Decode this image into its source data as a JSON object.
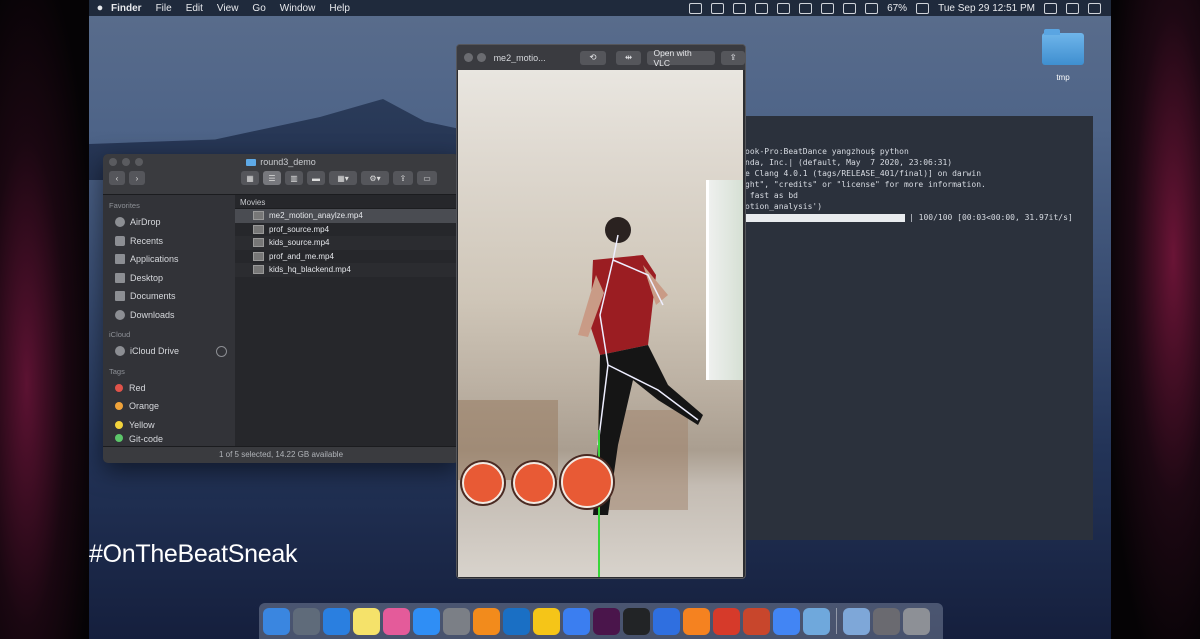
{
  "menubar": {
    "apple": "",
    "items": [
      "Finder",
      "File",
      "Edit",
      "View",
      "Go",
      "Window",
      "Help"
    ],
    "battery": "67%",
    "datetime": "Tue Sep 29  12:51 PM"
  },
  "desktop": {
    "folder_label": "tmp"
  },
  "terminal": {
    "lines": [
      "ook-Pro:BeatDance yangzhou$ python",
      "nda, Inc.| (default, May  7 2020, 23:06:31)",
      "e Clang 4.0.1 (tags/RELEASE_401/final)] on darwin",
      "ght\", \"credits\" or \"license\" for more information.",
      " fast as bd",
      "otion_analysis')"
    ],
    "progress_text": "| 100/100 [00:03<00:00, 31.97it/s]",
    "progress": 1.0
  },
  "finder": {
    "title": "round3_demo",
    "column_header": "Movies",
    "sidebar": {
      "favorites_header": "Favorites",
      "favorites": [
        "AirDrop",
        "Recents",
        "Applications",
        "Desktop",
        "Documents",
        "Downloads"
      ],
      "icloud_header": "iCloud",
      "icloud": [
        "iCloud Drive"
      ],
      "tags_header": "Tags",
      "tags": [
        {
          "label": "Red",
          "color": "#e0534a"
        },
        {
          "label": "Orange",
          "color": "#f0a33a"
        },
        {
          "label": "Yellow",
          "color": "#f2d33c"
        },
        {
          "label": "Git-code",
          "color": "#5cc66a"
        }
      ]
    },
    "files": [
      "me2_motion_anaylze.mp4",
      "prof_source.mp4",
      "kids_source.mp4",
      "prof_and_me.mp4",
      "kids_hq_blackend.mp4"
    ],
    "selected_index": 0,
    "status": "1 of 5 selected, 14.22 GB available"
  },
  "player": {
    "title": "me2_motio...",
    "open_with": "Open with VLC"
  },
  "overlay": {
    "hashtag": "#OnTheBeatSneak"
  },
  "dock": {
    "icons": [
      "finder-icon",
      "launchpad-icon",
      "safari-icon",
      "notes-icon",
      "photos-icon",
      "app-store-icon",
      "system-preferences-icon",
      "sublime-icon",
      "outlook-icon",
      "cyberduck-icon",
      "pen-icon",
      "slack-icon",
      "terminal-icon",
      "todo-icon",
      "vlc-icon",
      "acrobat-icon",
      "powerpoint-icon",
      "chrome-icon",
      "file-merge-icon",
      "preview-icon",
      "screenshot-icon",
      "trash-icon"
    ],
    "colors": [
      "#3a86e0",
      "#5f6b7a",
      "#2a7fe0",
      "#f5e26a",
      "#e45b9a",
      "#2f8ef5",
      "#7b7f86",
      "#f28b1c",
      "#1a6fc4",
      "#f5c518",
      "#3b7ef0",
      "#4a154b",
      "#222426",
      "#2f6fe0",
      "#f58220",
      "#d63a2a",
      "#c8462c",
      "#4285f4",
      "#6fa8dc",
      "#7ea7d8",
      "#6a6a70",
      "#8d9096"
    ]
  }
}
